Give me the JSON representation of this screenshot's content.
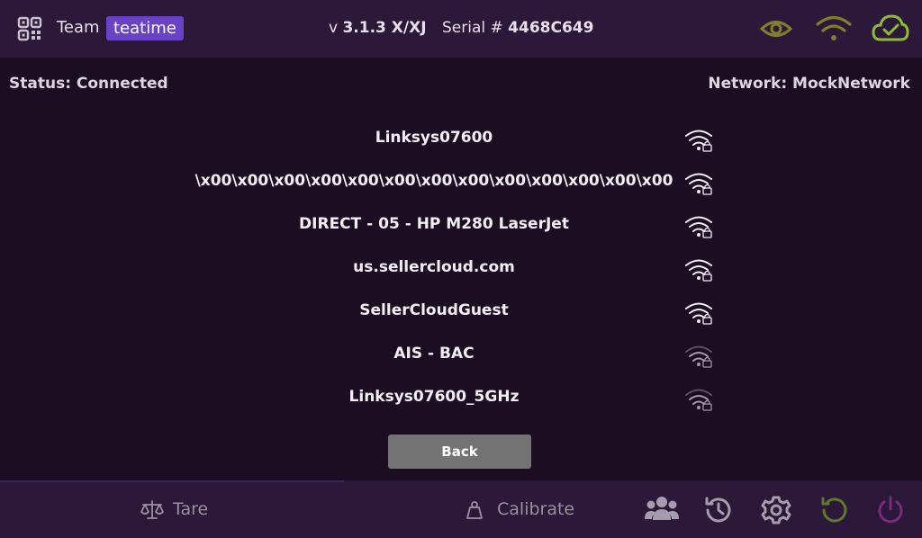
{
  "header": {
    "team_label": "Team",
    "team_name": "teatime",
    "version_prefix": "v",
    "version": "3.1.3 X/XJ",
    "serial_prefix": "Serial #",
    "serial": "4468C649",
    "icons": [
      "qr-code-icon",
      "eye-icon",
      "wifi-icon",
      "cloud-check-icon"
    ]
  },
  "status": {
    "text": "Status: Connected"
  },
  "network": {
    "text": "Network: MockNetwork"
  },
  "networks": [
    {
      "name": "Linksys07600",
      "signal": "strong",
      "secured": true
    },
    {
      "name": "\\x00\\x00\\x00\\x00\\x00\\x00\\x00\\x00\\x00\\x00\\x00\\x00\\x00",
      "signal": "strong",
      "secured": true
    },
    {
      "name": "DIRECT - 05 - HP M280 LaserJet",
      "signal": "strong",
      "secured": true
    },
    {
      "name": "us.sellercloud.com",
      "signal": "strong",
      "secured": true
    },
    {
      "name": "SellerCloudGuest",
      "signal": "strong",
      "secured": true
    },
    {
      "name": "AIS - BAC",
      "signal": "weak",
      "secured": true
    },
    {
      "name": "Linksys07600_5GHz",
      "signal": "weak",
      "secured": true
    }
  ],
  "buttons": {
    "back": "Back"
  },
  "footer": {
    "tare": "Tare",
    "calibrate": "Calibrate",
    "icons": [
      "users-icon",
      "history-icon",
      "settings-icon",
      "undo-icon",
      "power-icon"
    ]
  },
  "colors": {
    "background": "#1b0d22",
    "bar": "#2c1838",
    "accent": "#6a42c6",
    "status_green": "#8dbb32",
    "status_olive": "#7d7f2b",
    "power": "#7a2a7c"
  }
}
